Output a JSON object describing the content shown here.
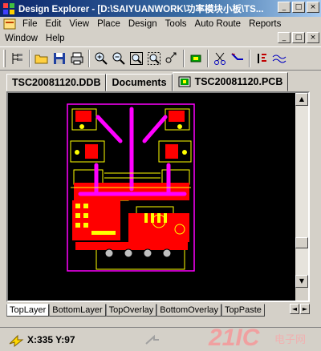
{
  "window": {
    "title": "Design Explorer - [D:\\SAIYUANWORK\\功率模块小板\\TS...",
    "minimize_glyph": "_",
    "maximize_glyph": "□",
    "close_glyph": "×"
  },
  "menu": {
    "row1": [
      "File",
      "Edit",
      "View",
      "Place",
      "Design",
      "Tools",
      "Auto Route",
      "Reports"
    ],
    "row2": [
      "Window",
      "Help"
    ]
  },
  "document_tabs": [
    {
      "label": "TSC20081120.DDB",
      "active": false
    },
    {
      "label": "Documents",
      "active": false
    },
    {
      "label": "TSC20081120.PCB",
      "active": true
    }
  ],
  "layer_tabs": [
    {
      "label": "TopLayer",
      "active": true
    },
    {
      "label": "BottomLayer",
      "active": false
    },
    {
      "label": "TopOverlay",
      "active": false
    },
    {
      "label": "BottomOverlay",
      "active": false
    },
    {
      "label": "TopPaste",
      "active": false
    }
  ],
  "status": {
    "coordinates": "X:335 Y:97"
  },
  "watermark": {
    "brand": "21IC",
    "sub": "电子网"
  },
  "colors": {
    "board_outline": "#ff00ff",
    "top_layer": "#ff0000",
    "overlay": "#ffff00",
    "canvas_bg": "#000000",
    "titlebar": "#0a246a"
  }
}
